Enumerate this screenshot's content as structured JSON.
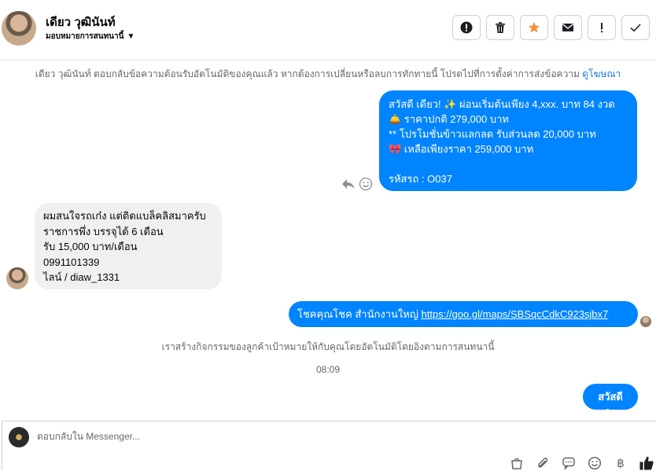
{
  "header": {
    "contact_name": "เดียว วุฒินันท์",
    "assign_label": "มอบหมายการสนทนานี้",
    "actions": [
      {
        "icon": "alert-circle-icon",
        "glyph": "!"
      },
      {
        "icon": "trash-icon"
      },
      {
        "icon": "star-icon",
        "color": "#f7923b"
      },
      {
        "icon": "envelope-icon"
      },
      {
        "icon": "exclamation-icon",
        "glyph": "!"
      },
      {
        "icon": "checkmark-icon",
        "glyph": "✓"
      }
    ]
  },
  "notice": {
    "text": "เดียว วุฒินันท์ ตอบกลับข้อความต้อนรับอัตโนมัติของคุณแล้ว หากต้องการเปลี่ยนหรือลบการทักทายนี้ โปรดไปที่การตั้งค่าการส่งข้อความ",
    "link": "ดูโฆษณา"
  },
  "messages": {
    "outgoing_1": {
      "lines": [
        "สวัสดี เดียว! ✨  ผ่อนเริ่มต้นเพียง 4,xxx. บาท 84 งวด",
        "🛎️ ราคาปกติ 279,000 บาท",
        "** โปรโมชั่นข้าวแลกลด รับส่วนลด 20,000 บาท",
        "🎀  เหลือเพียงราคา 259,000 บาท",
        "",
        " รหัสรถ : O037"
      ]
    },
    "incoming_1": {
      "lines": [
        "ผมสนใจรถเก๋ง แต่ติดแบล็คลิสมาครับ",
        "ราชการพึ่ง บรรจุได้ 6 เดือน",
        "รับ 15,000 บาท/เดือน",
        "0991101339",
        "ไลน์ / diaw_1331"
      ]
    },
    "outgoing_2": {
      "text": "โชคคุณโชค สำนักงานใหญ่",
      "link": "https://goo.gl/maps/SBSqcCdkC923sjbx7"
    },
    "outgoing_3": {
      "text": "สวัสดีคะ"
    }
  },
  "system_line": "เราสร้างกิจกรรมของลูกค้าเป้าหมายให้กับคุณโดยอัตโนมัติโดยอิงตามการสนทนานี้",
  "timestamp": "08:09",
  "composer": {
    "placeholder": "ตอบกลับใน Messenger...",
    "tools": [
      "shopping-bag-icon",
      "paperclip-icon",
      "chat-bubble-icon",
      "emoji-icon",
      "baht-icon",
      "thumbs-up-icon"
    ]
  },
  "colors": {
    "accent": "#0084ff",
    "incoming_bg": "#f0f0f0",
    "muted_text": "#65676b",
    "link": "#1877f2",
    "star": "#f7923b"
  }
}
